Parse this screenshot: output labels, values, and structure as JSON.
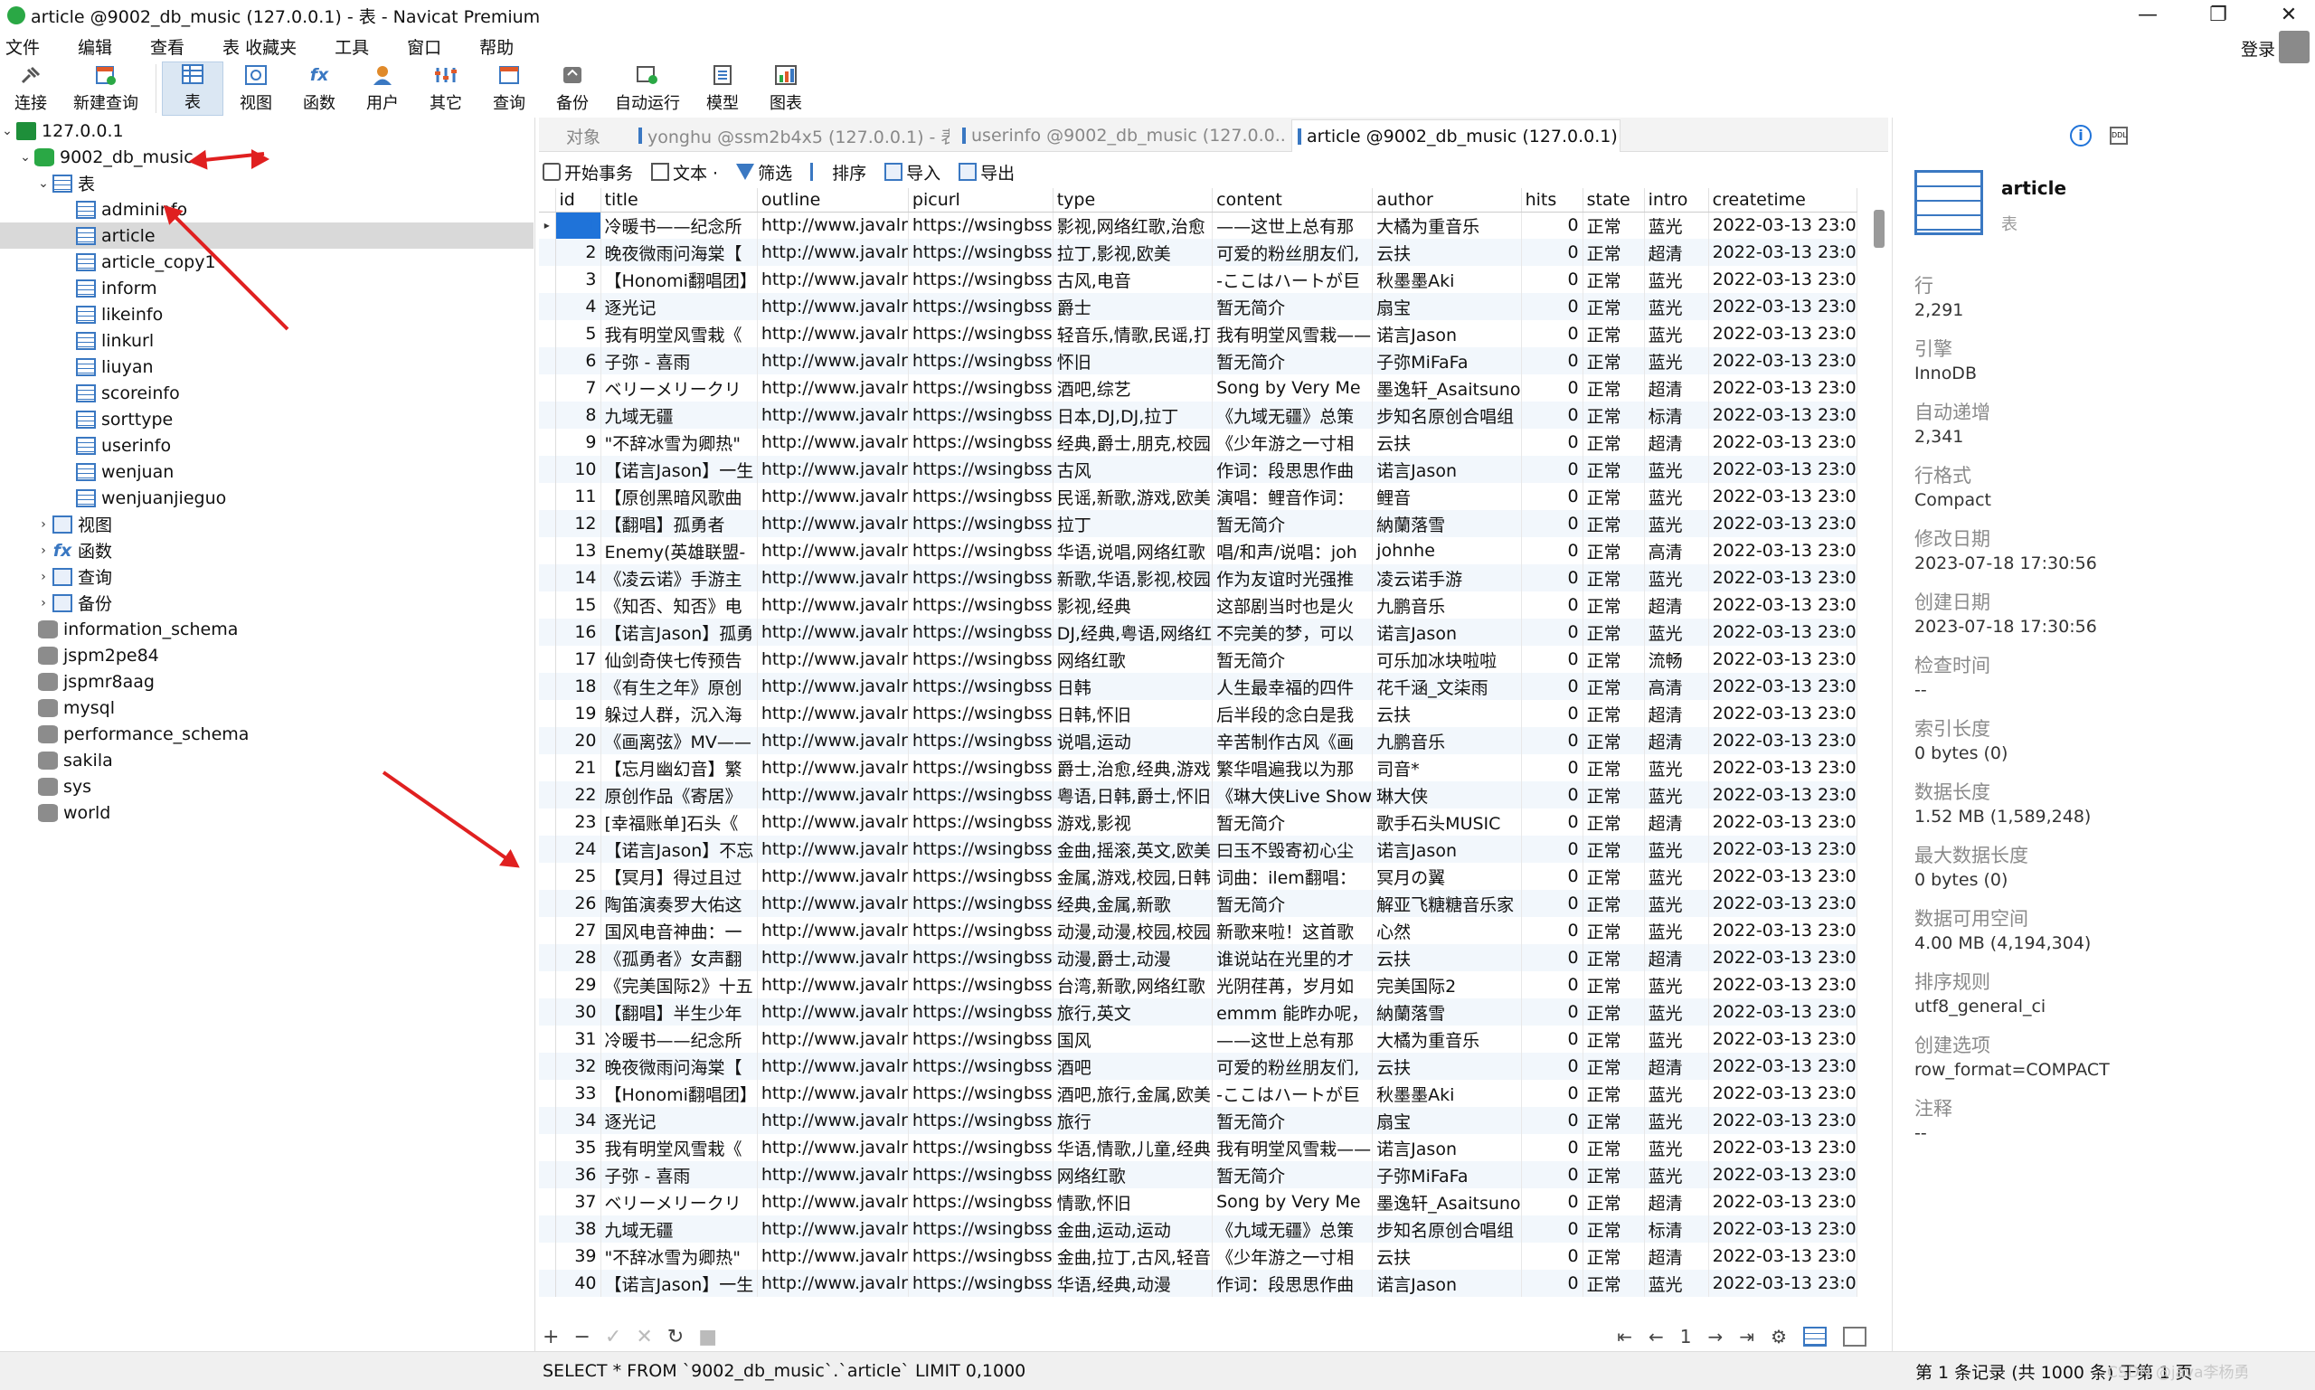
{
  "window": {
    "title": "article @9002_db_music (127.0.0.1) - 表 - Navicat Premium",
    "min": "—",
    "max": "❐",
    "close": "✕"
  },
  "menu": [
    "文件",
    "编辑",
    "查看",
    "表 收藏夹",
    "工具",
    "窗口",
    "帮助"
  ],
  "login": "登录",
  "toolbar": [
    "连接",
    "新建查询",
    "表",
    "视图",
    "函数",
    "用户",
    "其它",
    "查询",
    "备份",
    "自动运行",
    "模型",
    "图表"
  ],
  "tree": {
    "connection": "127.0.0.1",
    "database": "9002_db_music",
    "tables_label": "表",
    "tables": [
      "admininfo",
      "article",
      "article_copy1",
      "inform",
      "likeinfo",
      "linkurl",
      "liuyan",
      "scoreinfo",
      "sorttype",
      "userinfo",
      "wenjuan",
      "wenjuanjieguo"
    ],
    "folders": [
      "视图",
      "函数",
      "查询",
      "备份"
    ],
    "other_dbs": [
      "information_schema",
      "jspm2pe84",
      "jspmr8aag",
      "mysql",
      "performance_schema",
      "sakila",
      "sys",
      "world"
    ]
  },
  "tabs": {
    "object": "对象",
    "t1": "yonghu @ssm2b4x5 (127.0.0.1) - 表",
    "t2": "userinfo @9002_db_music (127.0.0....",
    "t3": "article @9002_db_music (127.0.0.1) ..."
  },
  "subtoolbar": [
    "开始事务",
    "文本 ·",
    "筛选",
    "排序",
    "导入",
    "导出"
  ],
  "columns": [
    "id",
    "title",
    "outline",
    "picurl",
    "type",
    "content",
    "author",
    "hits",
    "state",
    "intro",
    "createtime"
  ],
  "rows": [
    [
      "1",
      "冷暖书——纪念所",
      "http://www.javalr",
      "https://wsingbss",
      "影视,网络红歌,治愈",
      "——这世上总有那",
      "大橘为重音乐",
      "0",
      "正常",
      "蓝光",
      "2022-03-13 23:0"
    ],
    [
      "2",
      "晚夜微雨问海棠【",
      "http://www.javalr",
      "https://wsingbss",
      "拉丁,影视,欧美",
      "可爱的粉丝朋友们,",
      "云扶",
      "0",
      "正常",
      "超清",
      "2022-03-13 23:0"
    ],
    [
      "3",
      "【Honomi翻唱团】",
      "http://www.javalr",
      "https://wsingbss",
      "古风,电音",
      "-ここはハートが巨",
      "秋墨墨Aki",
      "0",
      "正常",
      "蓝光",
      "2022-03-13 23:0"
    ],
    [
      "4",
      "逐光记",
      "http://www.javalr",
      "https://wsingbss",
      "爵士",
      "暂无简介",
      "扇宝",
      "0",
      "正常",
      "蓝光",
      "2022-03-13 23:0"
    ],
    [
      "5",
      "我有明堂风雪栽《",
      "http://www.javalr",
      "https://wsingbss",
      "轻音乐,情歌,民谣,打",
      "我有明堂风雪栽——",
      "诺言Jason",
      "0",
      "正常",
      "蓝光",
      "2022-03-13 23:0"
    ],
    [
      "6",
      "子弥 - 喜雨",
      "http://www.javalr",
      "https://wsingbss",
      "怀旧",
      "暂无简介",
      "子弥MiFaFa",
      "0",
      "正常",
      "蓝光",
      "2022-03-13 23:0"
    ],
    [
      "7",
      "ベリーメリークリ",
      "http://www.javalr",
      "https://wsingbss",
      "酒吧,综艺",
      "Song by Very Me",
      "墨逸轩_Asaitsuno",
      "0",
      "正常",
      "超清",
      "2022-03-13 23:0"
    ],
    [
      "8",
      "九域无疆",
      "http://www.javalr",
      "https://wsingbss",
      "日本,DJ,DJ,拉丁",
      "《九域无疆》总策",
      "步知名原创合唱组",
      "0",
      "正常",
      "标清",
      "2022-03-13 23:0"
    ],
    [
      "9",
      "\"不辞冰雪为卿热\"",
      "http://www.javalr",
      "https://wsingbss",
      "经典,爵士,朋克,校园",
      "《少年游之一寸相",
      "云扶",
      "0",
      "正常",
      "超清",
      "2022-03-13 23:0"
    ],
    [
      "10",
      "【诺言Jason】一生",
      "http://www.javalr",
      "https://wsingbss",
      "古风",
      "作词：段思思作曲",
      "诺言Jason",
      "0",
      "正常",
      "蓝光",
      "2022-03-13 23:0"
    ],
    [
      "11",
      "【原创黑暗风歌曲",
      "http://www.javalr",
      "https://wsingbss",
      "民谣,新歌,游戏,欧美",
      "演唱：鲤音作词：",
      "鲤音",
      "0",
      "正常",
      "蓝光",
      "2022-03-13 23:0"
    ],
    [
      "12",
      "【翻唱】孤勇者",
      "http://www.javalr",
      "https://wsingbss",
      "拉丁",
      "暂无简介",
      "納蘭落雪",
      "0",
      "正常",
      "蓝光",
      "2022-03-13 23:0"
    ],
    [
      "13",
      "Enemy(英雄联盟-",
      "http://www.javalr",
      "https://wsingbss",
      "华语,说唱,网络红歌",
      "唱/和声/说唱：joh",
      "johnhe",
      "0",
      "正常",
      "高清",
      "2022-03-13 23:0"
    ],
    [
      "14",
      "《凌云诺》手游主",
      "http://www.javalr",
      "https://wsingbss",
      "新歌,华语,影视,校园",
      "作为友谊时光强推",
      "凌云诺手游",
      "0",
      "正常",
      "蓝光",
      "2022-03-13 23:0"
    ],
    [
      "15",
      "《知否、知否》电",
      "http://www.javalr",
      "https://wsingbss",
      "影视,经典",
      "这部剧当时也是火",
      "九鹏音乐",
      "0",
      "正常",
      "超清",
      "2022-03-13 23:0"
    ],
    [
      "16",
      "【诺言Jason】孤勇",
      "http://www.javalr",
      "https://wsingbss",
      "DJ,经典,粤语,网络红",
      "不完美的梦，可以",
      "诺言Jason",
      "0",
      "正常",
      "蓝光",
      "2022-03-13 23:0"
    ],
    [
      "17",
      "仙剑奇侠七传预告",
      "http://www.javalr",
      "https://wsingbss",
      "网络红歌",
      "暂无简介",
      "可乐加冰块啦啦",
      "0",
      "正常",
      "流畅",
      "2022-03-13 23:0"
    ],
    [
      "18",
      "《有生之年》原创",
      "http://www.javalr",
      "https://wsingbss",
      "日韩",
      "人生最幸福的四件",
      "花千涵_文柒雨",
      "0",
      "正常",
      "高清",
      "2022-03-13 23:0"
    ],
    [
      "19",
      "躲过人群，沉入海",
      "http://www.javalr",
      "https://wsingbss",
      "日韩,怀旧",
      "后半段的念白是我",
      "云扶",
      "0",
      "正常",
      "超清",
      "2022-03-13 23:0"
    ],
    [
      "20",
      "《画离弦》MV——",
      "http://www.javalr",
      "https://wsingbss",
      "说唱,运动",
      "辛苦制作古风《画",
      "九鹏音乐",
      "0",
      "正常",
      "超清",
      "2022-03-13 23:0"
    ],
    [
      "21",
      "【忘月幽幻音】繁",
      "http://www.javalr",
      "https://wsingbss",
      "爵士,治愈,经典,游戏",
      "繁华唱遍我以为那",
      "司音*",
      "0",
      "正常",
      "蓝光",
      "2022-03-13 23:0"
    ],
    [
      "22",
      "原创作品《寄居》",
      "http://www.javalr",
      "https://wsingbss",
      "粤语,日韩,爵士,怀旧",
      "《琳大侠Live Show",
      "琳大侠",
      "0",
      "正常",
      "蓝光",
      "2022-03-13 23:0"
    ],
    [
      "23",
      "[幸福账单]石头《",
      "http://www.javalr",
      "https://wsingbss",
      "游戏,影视",
      "暂无简介",
      "歌手石头MUSIC",
      "0",
      "正常",
      "超清",
      "2022-03-13 23:0"
    ],
    [
      "24",
      "【诺言Jason】不忘",
      "http://www.javalr",
      "https://wsingbss",
      "金曲,摇滚,英文,欧美",
      "曰玉不毁寄初心尘",
      "诺言Jason",
      "0",
      "正常",
      "蓝光",
      "2022-03-13 23:0"
    ],
    [
      "25",
      "【冥月】得过且过",
      "http://www.javalr",
      "https://wsingbss",
      "金属,游戏,校园,日韩",
      "词曲：ilem翻唱：",
      "冥月の翼",
      "0",
      "正常",
      "蓝光",
      "2022-03-13 23:0"
    ],
    [
      "26",
      "陶笛演奏罗大佑这",
      "http://www.javalr",
      "https://wsingbss",
      "经典,金属,新歌",
      "暂无简介",
      "解亚飞糖糖音乐家",
      "0",
      "正常",
      "蓝光",
      "2022-03-13 23:0"
    ],
    [
      "27",
      "国风电音神曲：一",
      "http://www.javalr",
      "https://wsingbss",
      "动漫,动漫,校园,校园",
      "新歌来啦！这首歌",
      "心然",
      "0",
      "正常",
      "蓝光",
      "2022-03-13 23:0"
    ],
    [
      "28",
      "《孤勇者》女声翻",
      "http://www.javalr",
      "https://wsingbss",
      "动漫,爵士,动漫",
      "谁说站在光里的才",
      "云扶",
      "0",
      "正常",
      "超清",
      "2022-03-13 23:0"
    ],
    [
      "29",
      "《完美国际2》十五",
      "http://www.javalr",
      "https://wsingbss",
      "台湾,新歌,网络红歌",
      "光阴荏苒，岁月如",
      "完美国际2",
      "0",
      "正常",
      "蓝光",
      "2022-03-13 23:0"
    ],
    [
      "30",
      "【翻唱】半生少年",
      "http://www.javalr",
      "https://wsingbss",
      "旅行,英文",
      "emmm 能昨办呢，",
      "納蘭落雪",
      "0",
      "正常",
      "蓝光",
      "2022-03-13 23:0"
    ],
    [
      "31",
      "冷暖书——纪念所",
      "http://www.javalr",
      "https://wsingbss",
      "国风",
      "——这世上总有那",
      "大橘为重音乐",
      "0",
      "正常",
      "蓝光",
      "2022-03-13 23:0"
    ],
    [
      "32",
      "晚夜微雨问海棠【",
      "http://www.javalr",
      "https://wsingbss",
      "酒吧",
      "可爱的粉丝朋友们,",
      "云扶",
      "0",
      "正常",
      "超清",
      "2022-03-13 23:0"
    ],
    [
      "33",
      "【Honomi翻唱团】",
      "http://www.javalr",
      "https://wsingbss",
      "酒吧,旅行,金属,欧美",
      "-ここはハートが巨",
      "秋墨墨Aki",
      "0",
      "正常",
      "蓝光",
      "2022-03-13 23:0"
    ],
    [
      "34",
      "逐光记",
      "http://www.javalr",
      "https://wsingbss",
      "旅行",
      "暂无简介",
      "扇宝",
      "0",
      "正常",
      "蓝光",
      "2022-03-13 23:0"
    ],
    [
      "35",
      "我有明堂风雪栽《",
      "http://www.javalr",
      "https://wsingbss",
      "华语,情歌,儿童,经典",
      "我有明堂风雪栽——",
      "诺言Jason",
      "0",
      "正常",
      "蓝光",
      "2022-03-13 23:0"
    ],
    [
      "36",
      "子弥 - 喜雨",
      "http://www.javalr",
      "https://wsingbss",
      "网络红歌",
      "暂无简介",
      "子弥MiFaFa",
      "0",
      "正常",
      "蓝光",
      "2022-03-13 23:0"
    ],
    [
      "37",
      "ベリーメリークリ",
      "http://www.javalr",
      "https://wsingbss",
      "情歌,怀旧",
      "Song by Very Me",
      "墨逸轩_Asaitsuno",
      "0",
      "正常",
      "超清",
      "2022-03-13 23:0"
    ],
    [
      "38",
      "九域无疆",
      "http://www.javalr",
      "https://wsingbss",
      "金曲,运动,运动",
      "《九域无疆》总策",
      "步知名原创合唱组",
      "0",
      "正常",
      "标清",
      "2022-03-13 23:0"
    ],
    [
      "39",
      "\"不辞冰雪为卿热\"",
      "http://www.javalr",
      "https://wsingbss",
      "金曲,拉丁,古风,轻音",
      "《少年游之一寸相",
      "云扶",
      "0",
      "正常",
      "超清",
      "2022-03-13 23:0"
    ],
    [
      "40",
      "【诺言Jason】一生",
      "http://www.javalr",
      "https://wsingbss",
      "华语,经典,动漫",
      "作词：段思思作曲",
      "诺言Jason",
      "0",
      "正常",
      "蓝光",
      "2022-03-13 23:0"
    ]
  ],
  "pager": {
    "first": "⇤",
    "prev": "←",
    "page": "1",
    "next": "→",
    "last": "⇥",
    "settings": "⚙"
  },
  "bottom": {
    "add": "+",
    "remove": "−",
    "apply": "✓",
    "discard": "✕",
    "refresh": "↻",
    "stop": "■"
  },
  "status": {
    "sql": "SELECT * FROM `9002_db_music`.`article` LIMIT 0,1000",
    "records": "第 1 条记录 (共 1000 条) 于第 1 页",
    "watermark": "CSDN @java李杨勇"
  },
  "info": {
    "name": "article",
    "type": "表",
    "props": [
      {
        "label": "行",
        "value": "2,291"
      },
      {
        "label": "引擎",
        "value": "InnoDB"
      },
      {
        "label": "自动递增",
        "value": "2,341"
      },
      {
        "label": "行格式",
        "value": "Compact"
      },
      {
        "label": "修改日期",
        "value": "2023-07-18 17:30:56"
      },
      {
        "label": "创建日期",
        "value": "2023-07-18 17:30:56"
      },
      {
        "label": "检查时间",
        "value": "--"
      },
      {
        "label": "索引长度",
        "value": "0 bytes (0)"
      },
      {
        "label": "数据长度",
        "value": "1.52 MB (1,589,248)"
      },
      {
        "label": "最大数据长度",
        "value": "0 bytes (0)"
      },
      {
        "label": "数据可用空间",
        "value": "4.00 MB (4,194,304)"
      },
      {
        "label": "排序规则",
        "value": "utf8_general_ci"
      },
      {
        "label": "创建选项",
        "value": "row_format=COMPACT"
      },
      {
        "label": "注释",
        "value": "--"
      }
    ]
  },
  "colors": {
    "accent": "#1f73d9",
    "table_icon": "#3a78c2",
    "db_icon": "#2aa845",
    "arrow": "#e02020"
  }
}
